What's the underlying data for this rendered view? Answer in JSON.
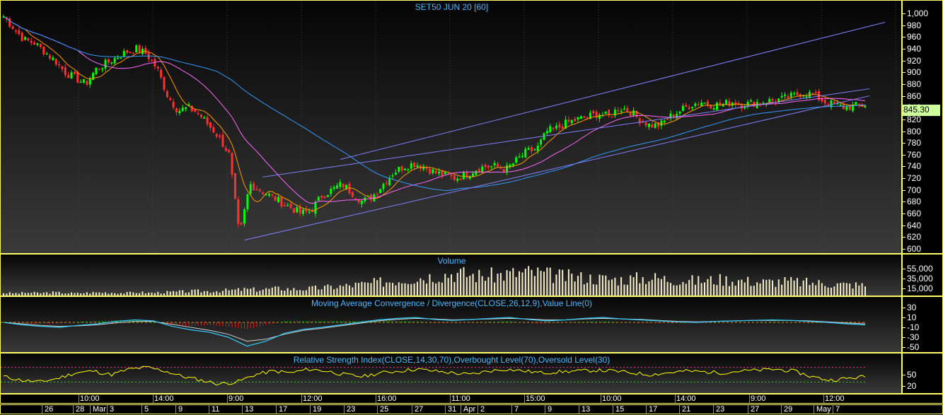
{
  "chart_data": [
    {
      "type": "candlestick",
      "title": "SET50 JUN 20   [60]",
      "ylim": [
        600,
        1000
      ],
      "y_ticks": [
        "1,000",
        "980",
        "960",
        "940",
        "920",
        "900",
        "880",
        "860",
        "840",
        "820",
        "800",
        "780",
        "760",
        "740",
        "720",
        "700",
        "680",
        "660",
        "640",
        "620",
        "600"
      ],
      "last_value": "845.30",
      "colors": {
        "up": "#00ff00",
        "down": "#ff3030",
        "ma_short": "#ff9900",
        "ma_mid": "#ff66ff",
        "ma_long": "#3399ff",
        "channel": "#8080ff"
      },
      "close_path": [
        995,
        975,
        955,
        950,
        935,
        920,
        900,
        890,
        880,
        905,
        915,
        925,
        935,
        940,
        930,
        905,
        860,
        835,
        840,
        830,
        810,
        790,
        760,
        620,
        710,
        700,
        690,
        680,
        670,
        660,
        665,
        690,
        700,
        710,
        695,
        680,
        690,
        710,
        730,
        740,
        745,
        740,
        730,
        725,
        720,
        725,
        735,
        740,
        740,
        735,
        750,
        765,
        770,
        800,
        805,
        815,
        820,
        825,
        830,
        825,
        840,
        835,
        820,
        810,
        810,
        825,
        835,
        845,
        850,
        845,
        845,
        850,
        845,
        848,
        850,
        852,
        855,
        860,
        865,
        862,
        850,
        845,
        840,
        843,
        845
      ]
    },
    {
      "type": "bar",
      "title": "Volume",
      "y_ticks": [
        "55,000",
        "35,000",
        "15,000"
      ],
      "ylim": [
        0,
        70000
      ],
      "values": [
        6000,
        5000,
        6500,
        5500,
        7000,
        6000,
        5000,
        6500,
        7000,
        6500,
        5500,
        7500,
        6000,
        7000,
        8000,
        9000,
        10000,
        9500,
        11000,
        12000,
        14000,
        13000,
        15000,
        16000,
        14000,
        15000,
        17000,
        19000,
        21000,
        24000,
        26000,
        30000,
        33000,
        37000,
        40000,
        43000,
        46000,
        50000,
        48000,
        45000,
        44000,
        47000,
        49000,
        52000,
        50000,
        46000,
        43000,
        41000,
        40000,
        38000,
        37000,
        36000,
        38000,
        40000,
        39000,
        36000,
        35000,
        33000,
        34000,
        36000,
        35000,
        33000,
        31000,
        30000,
        32000,
        31000,
        29000,
        28000,
        27000,
        25000,
        24000,
        23000
      ]
    },
    {
      "type": "line",
      "title": "Moving Average Convergence / Divergence(CLOSE,26,12,9),Value Line(0)",
      "y_ticks": [
        "30",
        "10",
        "-10",
        "-30",
        "-50"
      ],
      "ylim": [
        -60,
        40
      ],
      "macd": [
        0,
        -5,
        -8,
        -10,
        -6,
        -3,
        2,
        5,
        3,
        -8,
        -15,
        -20,
        -30,
        -48,
        -38,
        -22,
        -14,
        -10,
        -5,
        0,
        5,
        8,
        10,
        6,
        4,
        6,
        8,
        10,
        6,
        3,
        5,
        8,
        10,
        7,
        5,
        3,
        1,
        0,
        2,
        3,
        4,
        5,
        4,
        2,
        0,
        -3,
        -5
      ],
      "signal": [
        0,
        -3,
        -6,
        -8,
        -7,
        -5,
        -1,
        2,
        2,
        -4,
        -10,
        -16,
        -24,
        -38,
        -34,
        -24,
        -16,
        -12,
        -7,
        -2,
        3,
        6,
        8,
        7,
        5,
        6,
        7,
        8,
        7,
        5,
        5,
        7,
        8,
        7,
        6,
        4,
        2,
        1,
        2,
        3,
        4,
        4,
        4,
        3,
        1,
        -1,
        -3
      ]
    },
    {
      "type": "line",
      "title": "Relative Strength Index(CLOSE,14,30,70),Overbought Level(70),Oversold Level(30)",
      "y_ticks": [
        "50",
        "20"
      ],
      "ylim": [
        0,
        100
      ],
      "overbought": 70,
      "oversold": 30,
      "values": [
        45,
        35,
        30,
        40,
        55,
        60,
        50,
        65,
        70,
        60,
        45,
        35,
        25,
        30,
        50,
        60,
        55,
        65,
        60,
        50,
        45,
        55,
        60,
        65,
        60,
        55,
        50,
        60,
        65,
        60,
        55,
        58,
        60,
        62,
        60,
        55,
        50,
        55,
        60,
        58,
        55,
        60,
        62,
        65,
        60,
        45,
        35,
        40,
        45
      ]
    }
  ],
  "time_axis": {
    "times": [
      "10:00",
      "14:00",
      "9:00",
      "12:00",
      "16:00",
      "11:00",
      "15:00",
      "10:00",
      "14:00",
      "9:00",
      "12:00"
    ],
    "dates": [
      "26",
      "28",
      "Mar",
      "3",
      "5",
      "9",
      "11",
      "13",
      "17",
      "19",
      "23",
      "25",
      "27",
      "31",
      "Apr",
      "2",
      "7",
      "9",
      "13",
      "15",
      "17",
      "21",
      "23",
      "27",
      "29",
      "May",
      "7"
    ]
  }
}
